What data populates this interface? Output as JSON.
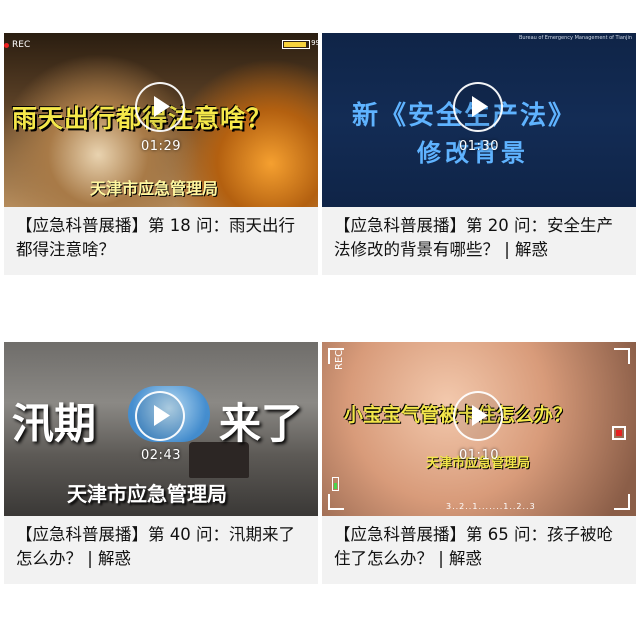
{
  "cards": [
    {
      "caption": "【应急科普展播】第 18 问：雨天出行都得注意啥？",
      "thumb_title": "雨天出行都得注意啥？",
      "thumb_sub": "天津市应急管理局",
      "rec": "REC",
      "duration": "01:29",
      "battery": "99"
    },
    {
      "caption": "【应急科普展播】第 20 问：安全生产法修改的背景有哪些？ | 解惑",
      "thumb_title": "新《安全生产法》",
      "thumb_sub": "修改背景",
      "duration": "01:30",
      "corner_text": "Bureau of Emergency Management of Tianjin"
    },
    {
      "caption": "【应急科普展播】第 40 问：汛期来了怎么办？ | 解惑",
      "thumb_title_left": "汛期",
      "thumb_title_right": "来了",
      "thumb_sub": "天津市应急管理局",
      "duration": "02:43"
    },
    {
      "caption": "【应急科普展播】第 65 问：孩子被呛住了怎么办？ | 解惑",
      "thumb_title": "小宝宝气管被卡住怎么办？",
      "thumb_sub": "天津市应急管理局",
      "rec": "REC",
      "duration": "01:10",
      "scale": "3..2..1.......1..2..3"
    }
  ],
  "colors": {
    "card_bg": "#f2f2f2",
    "page_bg": "#ffffff"
  },
  "icons": {
    "play": "play-icon"
  }
}
